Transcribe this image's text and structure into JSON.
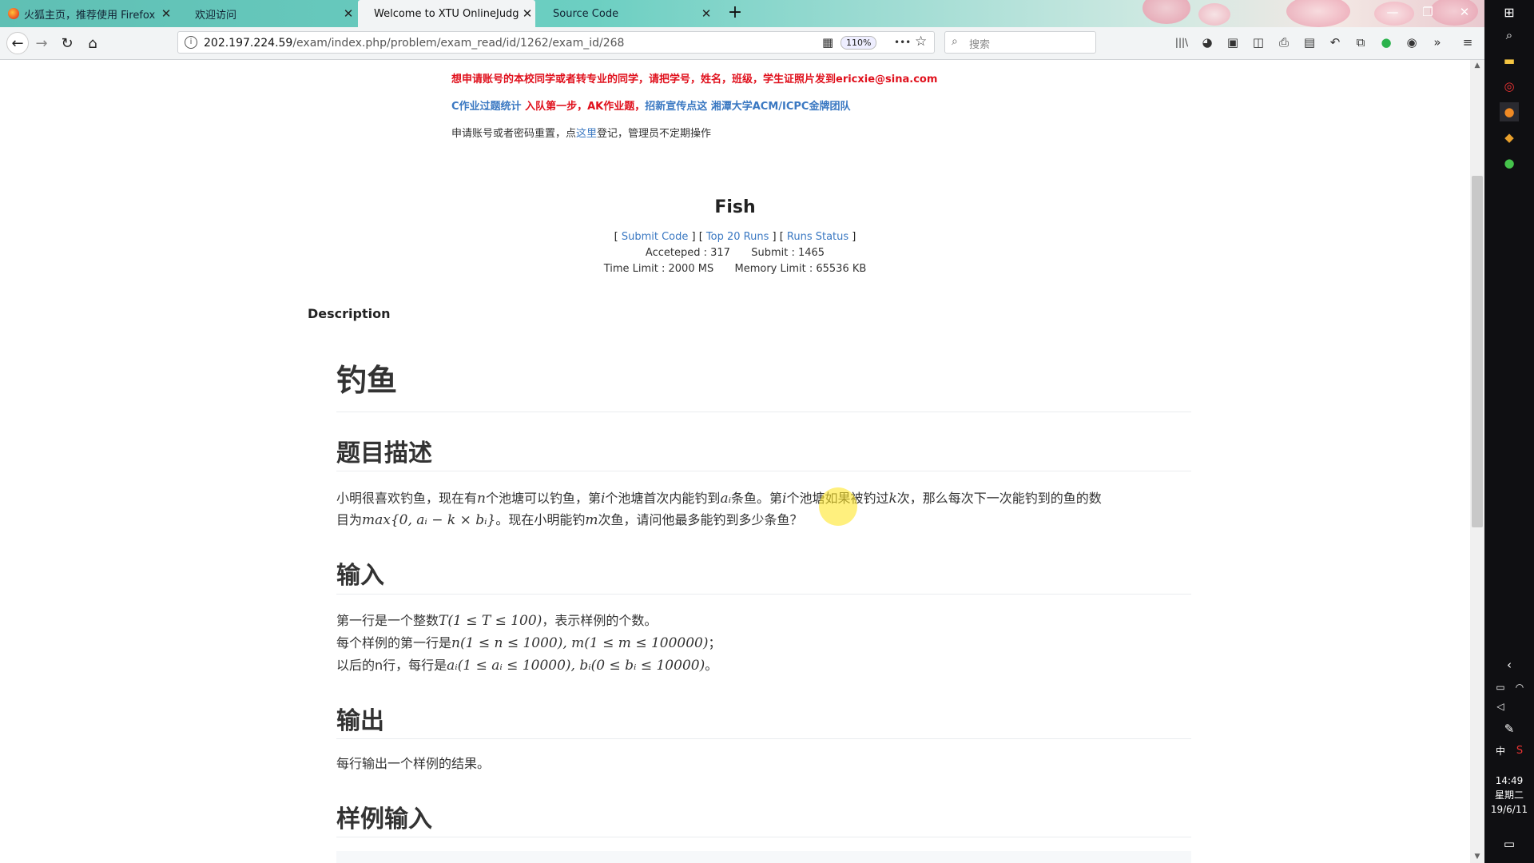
{
  "browser": {
    "tabs": [
      {
        "title": "火狐主页，推荐使用 Firefox 火",
        "active": false
      },
      {
        "title": "欢迎访问",
        "active": false
      },
      {
        "title": "Welcome to XTU OnlineJudge",
        "active": true
      },
      {
        "title": "Source Code",
        "active": false
      }
    ],
    "url_host": "202.197.224.59",
    "url_path": "/exam/index.php/problem/exam_read/id/1262/exam_id/268",
    "zoom": "110%",
    "search_placeholder": "搜索",
    "icons": {
      "back": "←",
      "forward": "→",
      "reload": "↻",
      "home": "⌂",
      "info": "i",
      "qr": "▦",
      "more": "•••",
      "star": "☆",
      "library": "|||\\",
      "menu": "≡",
      "overflow": "»"
    }
  },
  "notices": {
    "line1": "想申请账号的本校同学或者转专业的同学，请把学号，姓名，班级，学生证照片发到ericxie@sina.com",
    "line2_blue": "C作业过题统计",
    "line2_red": " 入队第一步，AK作业题，",
    "line2_blue2": "招新宣传点这 湘潭大学ACM/ICPC金牌团队",
    "line3_pre": "申请账号或者密码重置，点",
    "line3_link": "这里",
    "line3_post": "登记，管理员不定期操作"
  },
  "problem": {
    "title": "Fish",
    "links": {
      "submit": "Submit Code",
      "top20": "Top 20 Runs",
      "status": "Runs Status"
    },
    "accepted_label": "Acceteped : 317",
    "submit_label": "Submit : 1465",
    "time_limit": "Time Limit : 2000 MS",
    "memory_limit": "Memory Limit : 65536 KB",
    "description_label": "Description"
  },
  "statement": {
    "h1": "钓鱼",
    "h_desc": "题目描述",
    "desc_l1_a": "小明很喜欢钓鱼，现在有",
    "desc_l1_n": "n",
    "desc_l1_b": "个池塘可以钓鱼，第",
    "desc_l1_i": "i",
    "desc_l1_c": "个池塘首次内能钓到",
    "desc_l1_ai": "aᵢ",
    "desc_l1_d": "条鱼。第",
    "desc_l1_i2": "i",
    "desc_l1_e": "个池塘如果被钓过",
    "desc_l1_k": "k",
    "desc_l1_f": "次，那么每次下一次能钓到的鱼的数",
    "desc_l2_a": "目为",
    "desc_l2_math": "max{0, aᵢ − k × bᵢ}",
    "desc_l2_b": "。现在小明能钓",
    "desc_l2_m": "m",
    "desc_l2_c": "次鱼，请问他最多能钓到多少条鱼？",
    "h_input": "输入",
    "in_l1_a": "第一行是一个整数",
    "in_l1_math": "T(1 ≤ T ≤ 100)",
    "in_l1_b": "，表示样例的个数。",
    "in_l2_a": "每个样例的第一行是",
    "in_l2_math": "n(1 ≤ n ≤ 1000), m(1 ≤ m ≤ 100000)",
    "in_l2_b": "；",
    "in_l3_a": "以后的n行，每行是",
    "in_l3_math": "aᵢ(1 ≤ aᵢ ≤ 10000), bᵢ(0 ≤ bᵢ ≤ 10000)",
    "in_l3_b": "。",
    "h_output": "输出",
    "out_l1": "每行输出一个样例的结果。",
    "h_sample_in": "样例输入"
  },
  "taskbar": {
    "time": "14:49",
    "weekday": "星期二",
    "date": "19/6/11",
    "ime": "中"
  }
}
